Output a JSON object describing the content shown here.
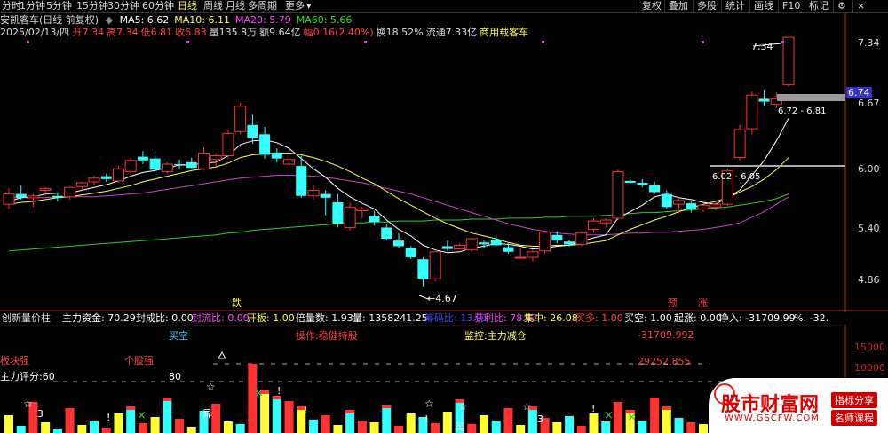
{
  "toolbar": {
    "periods": [
      {
        "label": "分时"
      },
      {
        "label": "1分钟"
      },
      {
        "label": "5分钟"
      },
      {
        "label": "15分钟"
      },
      {
        "label": "30分钟"
      },
      {
        "label": "60分钟"
      },
      {
        "label": "日线",
        "active": true
      },
      {
        "label": "周线"
      },
      {
        "label": "月线"
      },
      {
        "label": "多周期"
      },
      {
        "label": "更多"
      }
    ],
    "more_arrow": "▾",
    "right_buttons": [
      {
        "label": "复权"
      },
      {
        "label": "叠加"
      },
      {
        "label": "多股"
      },
      {
        "label": "统计"
      },
      {
        "label": "画线"
      },
      {
        "label": "F10"
      },
      {
        "label": "标记"
      }
    ],
    "icons": {
      "settings": "⚙",
      "close": "×"
    }
  },
  "header": {
    "stock_name": "安凯客车(日线 前复权)",
    "ma": [
      {
        "label": "MA5: 6.62",
        "color": "#ffffff"
      },
      {
        "label": "MA10: 6.11",
        "color": "#ffff55"
      },
      {
        "label": "MA20: 5.79",
        "color": "#ff44ff"
      },
      {
        "label": "MA60: 5.66",
        "color": "#33dd33"
      }
    ],
    "date": "2025/02/13/四",
    "quote_items": [
      {
        "text": "开7.34",
        "color": "#ff4444"
      },
      {
        "text": "高7.34",
        "color": "#ff4444"
      },
      {
        "text": "低6.81",
        "color": "#ff4444"
      },
      {
        "text": "收6.83",
        "color": "#ff4444"
      },
      {
        "text": "量135.8万",
        "color": "#dddddd"
      },
      {
        "text": "额9.64亿",
        "color": "#dddddd"
      },
      {
        "text": "幅0.16(2.40%)",
        "color": "#ff4444"
      },
      {
        "text": "换18.52%",
        "color": "#dddddd"
      },
      {
        "text": "流通7.33亿",
        "color": "#dddddd"
      },
      {
        "text": "商用载客车",
        "color": "#ffff55"
      }
    ]
  },
  "price_axis": {
    "labels": [
      "7.34",
      "6.67",
      "6.00",
      "5.40",
      "4.86"
    ],
    "current_price": "6.74"
  },
  "annotations": {
    "high_price": "7.34",
    "low_price": "4.67",
    "range1": "6.72 - 6.81",
    "range2": "6.02 - 6.05",
    "limit_down_tag": "跌",
    "pre_tag": "预",
    "limit_up_tag": "涨"
  },
  "indicator_bar": {
    "items": [
      {
        "text": "创新量价柱",
        "color": "#dddddd"
      },
      {
        "text": "主力资金: 70.29",
        "color": "#ffffff"
      },
      {
        "text": "封成比: 0.00",
        "color": "#ffffff"
      },
      {
        "text": "封流比: 0.00",
        "color": "#ff44ff"
      },
      {
        "text": "开板: 1.00",
        "color": "#ffff55"
      },
      {
        "text": "倍量数: 1.93",
        "color": "#ffffff"
      },
      {
        "text": "量: 1358241.25",
        "color": "#ffffff"
      },
      {
        "text": "筹码比: 13.91",
        "color": "#4444ff"
      },
      {
        "text": "获利比: 78.42",
        "color": "#ff44ff"
      },
      {
        "text": "集中: 26.08",
        "color": "#ffff55"
      },
      {
        "text": "买多: 1.00",
        "color": "#ff4444"
      },
      {
        "text": "买空: 1.00",
        "color": "#ffffff"
      },
      {
        "text": "起涨: 0.00",
        "color": "#ffffff"
      },
      {
        "text": "净入: -31709.99",
        "color": "#ffffff"
      },
      {
        "text": "%: -32.",
        "color": "#ffffff"
      }
    ]
  },
  "sub_panel": {
    "buy_empty": "买空",
    "operation": "操作:稳健持股",
    "monitor": "监控:主力减仓",
    "net_value": "-31709.992",
    "block_strong": "板块强",
    "individual_strong": "个股强",
    "main_score": "主力评分:60",
    "score_80": "80",
    "value_label": "29252.855",
    "axis_labels": [
      "15000",
      "10000",
      "5000"
    ],
    "bottom_marks": [
      "3",
      "3",
      "异",
      "买"
    ]
  },
  "watermark": {
    "site_name": "股市财富网",
    "site_url": "WWW.GSCFW.COM",
    "tag1": "指标分享",
    "tag2": "名师课程"
  },
  "colors": {
    "up": "#ff3333",
    "down": "#33ffff",
    "ma5": "#ffffff",
    "ma10": "#ffff55",
    "ma20": "#cc44cc",
    "ma60": "#33cc33",
    "axis": "#cc2222"
  },
  "chart_data": {
    "type": "candlestick",
    "ylim": [
      4.6,
      7.55
    ],
    "candles": [
      [
        5.55,
        5.72,
        5.5,
        5.66
      ],
      [
        5.66,
        5.75,
        5.6,
        5.62
      ],
      [
        5.62,
        5.66,
        5.52,
        5.64
      ],
      [
        5.7,
        5.73,
        5.64,
        5.72
      ],
      [
        5.64,
        5.68,
        5.58,
        5.62
      ],
      [
        5.63,
        5.74,
        5.6,
        5.73
      ],
      [
        5.74,
        5.79,
        5.7,
        5.78
      ],
      [
        5.79,
        5.86,
        5.76,
        5.83
      ],
      [
        5.85,
        5.88,
        5.79,
        5.82
      ],
      [
        5.8,
        5.96,
        5.78,
        5.93
      ],
      [
        5.9,
        6.05,
        5.86,
        6.02
      ],
      [
        6.06,
        6.12,
        5.98,
        6.02
      ],
      [
        6.04,
        6.08,
        5.9,
        5.92
      ],
      [
        5.9,
        6.0,
        5.88,
        5.98
      ],
      [
        5.98,
        6.03,
        5.93,
        5.97
      ],
      [
        6.0,
        6.05,
        5.93,
        5.94
      ],
      [
        5.93,
        6.16,
        5.91,
        6.1
      ],
      [
        6.03,
        6.09,
        5.95,
        6.07
      ],
      [
        6.07,
        6.35,
        6.04,
        6.31
      ],
      [
        6.33,
        6.64,
        6.3,
        6.6
      ],
      [
        6.4,
        6.51,
        6.2,
        6.26
      ],
      [
        6.3,
        6.38,
        6.04,
        6.08
      ],
      [
        6.1,
        6.15,
        6.0,
        6.04
      ],
      [
        5.98,
        6.08,
        5.94,
        6.03
      ],
      [
        5.96,
        6.07,
        5.62,
        5.64
      ],
      [
        5.64,
        5.76,
        5.6,
        5.7
      ],
      [
        5.66,
        5.7,
        5.43,
        5.62
      ],
      [
        5.57,
        5.66,
        5.3,
        5.34
      ],
      [
        5.3,
        5.57,
        5.27,
        5.52
      ],
      [
        5.48,
        5.52,
        5.4,
        5.5
      ],
      [
        5.42,
        5.48,
        5.32,
        5.36
      ],
      [
        5.3,
        5.34,
        5.16,
        5.18
      ],
      [
        5.16,
        5.24,
        5.08,
        5.1
      ],
      [
        5.08,
        5.1,
        4.96,
        4.98
      ],
      [
        4.96,
        4.98,
        4.67,
        4.75
      ],
      [
        4.75,
        5.04,
        4.72,
        5.04
      ],
      [
        5.1,
        5.16,
        5.05,
        5.07
      ],
      [
        5.07,
        5.13,
        5.06,
        5.11
      ],
      [
        5.06,
        5.19,
        5.04,
        5.18
      ],
      [
        5.14,
        5.16,
        5.08,
        5.12
      ],
      [
        5.17,
        5.22,
        5.1,
        5.11
      ],
      [
        5.09,
        5.13,
        5.02,
        5.04
      ],
      [
        4.98,
        5.08,
        4.96,
        4.98
      ],
      [
        4.98,
        5.06,
        4.94,
        5.04
      ],
      [
        5.05,
        5.27,
        5.02,
        5.25
      ],
      [
        5.22,
        5.26,
        5.13,
        5.16
      ],
      [
        5.15,
        5.17,
        5.1,
        5.12
      ],
      [
        5.12,
        5.26,
        5.1,
        5.24
      ],
      [
        5.28,
        5.4,
        5.24,
        5.37
      ],
      [
        5.35,
        5.4,
        5.3,
        5.38
      ],
      [
        5.4,
        5.92,
        5.38,
        5.9
      ],
      [
        5.8,
        5.82,
        5.76,
        5.78
      ],
      [
        5.78,
        5.82,
        5.73,
        5.76
      ],
      [
        5.76,
        5.79,
        5.66,
        5.68
      ],
      [
        5.66,
        5.7,
        5.5,
        5.52
      ],
      [
        5.55,
        5.6,
        5.45,
        5.59
      ],
      [
        5.56,
        5.59,
        5.46,
        5.5
      ],
      [
        5.5,
        5.56,
        5.47,
        5.54
      ],
      [
        5.52,
        5.58,
        5.49,
        5.55
      ],
      [
        5.55,
        5.93,
        5.53,
        5.91
      ],
      [
        6.05,
        6.4,
        6.02,
        6.35
      ],
      [
        6.36,
        6.76,
        6.3,
        6.72
      ],
      [
        6.68,
        6.78,
        6.6,
        6.65
      ],
      [
        6.62,
        6.75,
        6.58,
        6.68
      ],
      [
        6.83,
        7.34,
        6.81,
        7.34
      ]
    ],
    "ma5": [
      5.58,
      5.62,
      5.63,
      5.66,
      5.67,
      5.67,
      5.7,
      5.73,
      5.76,
      5.8,
      5.85,
      5.89,
      5.91,
      5.94,
      5.97,
      5.97,
      5.99,
      6.0,
      6.07,
      6.19,
      6.23,
      6.24,
      6.21,
      6.15,
      6.04,
      5.93,
      5.84,
      5.72,
      5.63,
      5.56,
      5.5,
      5.38,
      5.28,
      5.21,
      5.11,
      5.06,
      5.03,
      5.04,
      5.08,
      5.1,
      5.13,
      5.12,
      5.1,
      5.07,
      5.08,
      5.1,
      5.11,
      5.15,
      5.19,
      5.22,
      5.4,
      5.47,
      5.54,
      5.63,
      5.66,
      5.62,
      5.6,
      5.57,
      5.55,
      5.62,
      5.7,
      5.86,
      6.02,
      6.23,
      6.47
    ],
    "ma10": [
      5.55,
      5.57,
      5.58,
      5.6,
      5.62,
      5.63,
      5.65,
      5.67,
      5.69,
      5.72,
      5.75,
      5.79,
      5.82,
      5.85,
      5.88,
      5.91,
      5.93,
      5.95,
      5.99,
      6.05,
      6.08,
      6.09,
      6.1,
      6.1,
      6.08,
      6.05,
      6.01,
      5.96,
      5.9,
      5.83,
      5.77,
      5.69,
      5.61,
      5.54,
      5.47,
      5.4,
      5.34,
      5.29,
      5.24,
      5.21,
      5.18,
      5.14,
      5.11,
      5.1,
      5.1,
      5.11,
      5.11,
      5.12,
      5.14,
      5.16,
      5.22,
      5.28,
      5.33,
      5.38,
      5.42,
      5.47,
      5.51,
      5.55,
      5.58,
      5.62,
      5.68,
      5.74,
      5.82,
      5.92,
      6.05
    ],
    "ma20": [
      5.62,
      5.62,
      5.62,
      5.62,
      5.63,
      5.63,
      5.63,
      5.63,
      5.64,
      5.65,
      5.66,
      5.67,
      5.69,
      5.71,
      5.73,
      5.75,
      5.77,
      5.79,
      5.81,
      5.83,
      5.84,
      5.85,
      5.86,
      5.86,
      5.86,
      5.85,
      5.84,
      5.82,
      5.8,
      5.78,
      5.75,
      5.72,
      5.69,
      5.66,
      5.62,
      5.58,
      5.54,
      5.5,
      5.46,
      5.42,
      5.38,
      5.34,
      5.31,
      5.28,
      5.26,
      5.24,
      5.23,
      5.22,
      5.22,
      5.22,
      5.23,
      5.24,
      5.24,
      5.25,
      5.25,
      5.26,
      5.27,
      5.28,
      5.3,
      5.32,
      5.35,
      5.41,
      5.47,
      5.55,
      5.63
    ],
    "ma60": [
      5.05,
      5.06,
      5.07,
      5.08,
      5.09,
      5.1,
      5.11,
      5.12,
      5.13,
      5.14,
      5.15,
      5.16,
      5.17,
      5.18,
      5.19,
      5.2,
      5.21,
      5.22,
      5.24,
      5.25,
      5.27,
      5.28,
      5.29,
      5.3,
      5.31,
      5.32,
      5.33,
      5.34,
      5.35,
      5.35,
      5.36,
      5.36,
      5.37,
      5.37,
      5.37,
      5.38,
      5.38,
      5.38,
      5.39,
      5.39,
      5.39,
      5.4,
      5.4,
      5.4,
      5.41,
      5.41,
      5.42,
      5.42,
      5.42,
      5.43,
      5.44,
      5.45,
      5.46,
      5.46,
      5.47,
      5.48,
      5.49,
      5.5,
      5.51,
      5.52,
      5.54,
      5.56,
      5.58,
      5.61,
      5.66
    ]
  }
}
